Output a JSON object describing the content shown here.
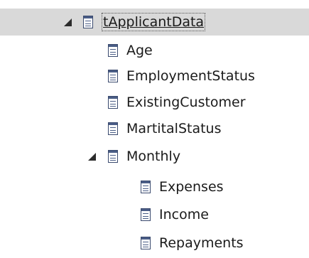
{
  "tree": {
    "root": {
      "label": "tApplicantData",
      "icon": "table-icon",
      "expanded": true,
      "selected": true,
      "children": [
        {
          "label": "Age",
          "icon": "attribute-icon"
        },
        {
          "label": "EmploymentStatus",
          "icon": "attribute-icon"
        },
        {
          "label": "ExistingCustomer",
          "icon": "attribute-icon"
        },
        {
          "label": "MartitalStatus",
          "icon": "attribute-icon"
        },
        {
          "label": "Monthly",
          "icon": "table-icon",
          "expanded": true,
          "children": [
            {
              "label": "Expenses",
              "icon": "attribute-icon"
            },
            {
              "label": "Income",
              "icon": "attribute-icon"
            },
            {
              "label": "Repayments",
              "icon": "attribute-icon"
            }
          ]
        }
      ]
    }
  },
  "colors": {
    "selection_background": "#d9d9d9",
    "icon_stroke": "#3a4a6e",
    "text": "#1a1a1a"
  }
}
